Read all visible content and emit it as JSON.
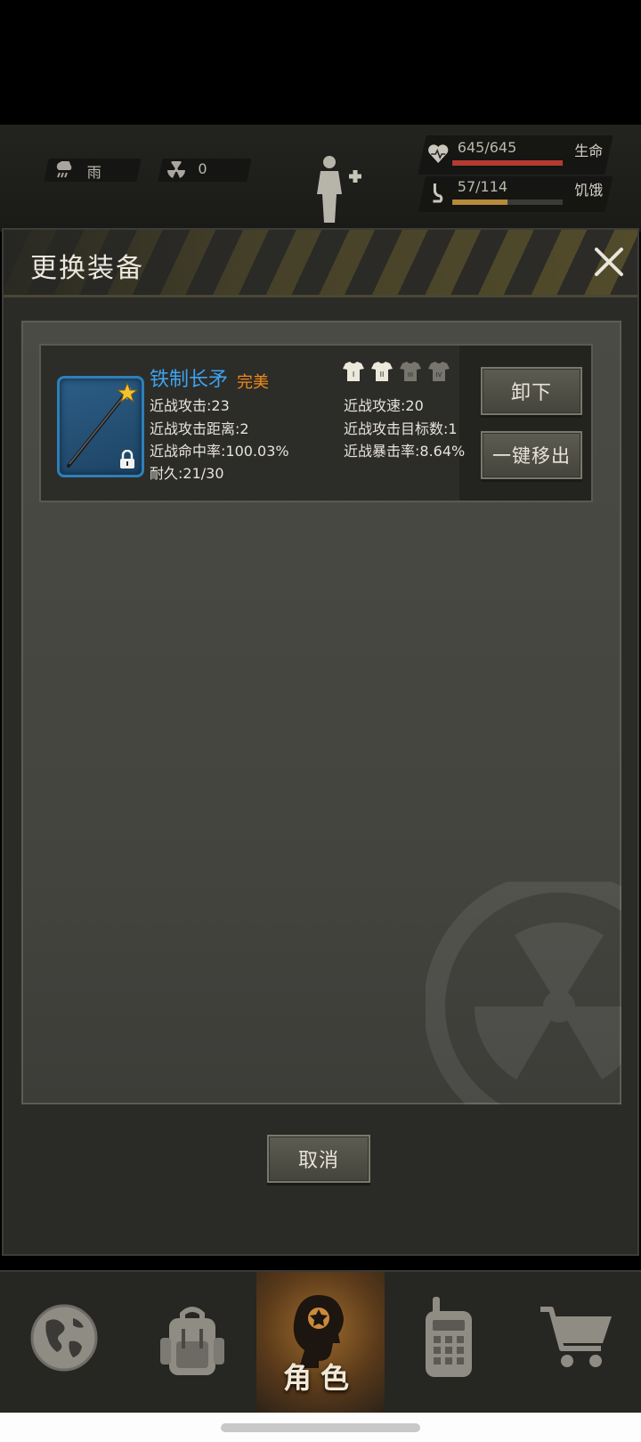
{
  "hud": {
    "weather": "雨",
    "radiation": "0",
    "health": {
      "value": "645/645",
      "label": "生命",
      "fill": 1.0,
      "color": "#b53b32"
    },
    "hunger": {
      "value": "57/114",
      "label": "饥饿",
      "fill": 0.5,
      "color": "#b58a3b"
    }
  },
  "modal": {
    "title": "更换装备"
  },
  "item": {
    "name": "铁制长矛",
    "quality": "完美",
    "stats_left": [
      "近战攻击:23",
      "近战攻击距离:2",
      "近战命中率:100.03%",
      "耐久:21/30"
    ],
    "stats_right": [
      "近战攻速:20",
      "近战攻击目标数:1",
      "近战暴击率:8.64%"
    ],
    "tiers": [
      "I",
      "II",
      "III",
      "IV"
    ],
    "tiers_unlocked": 2,
    "unequip_label": "卸下",
    "remove_all_label": "一键移出"
  },
  "footer": {
    "cancel_label": "取消"
  },
  "nav": {
    "active_label": "角色",
    "items": [
      "globe-icon",
      "backpack-icon",
      "character-icon",
      "walkie-talkie-icon",
      "shopping-cart-icon"
    ]
  },
  "colors": {
    "item_name": "#3ea3ef",
    "quality": "#ef8a1a"
  }
}
